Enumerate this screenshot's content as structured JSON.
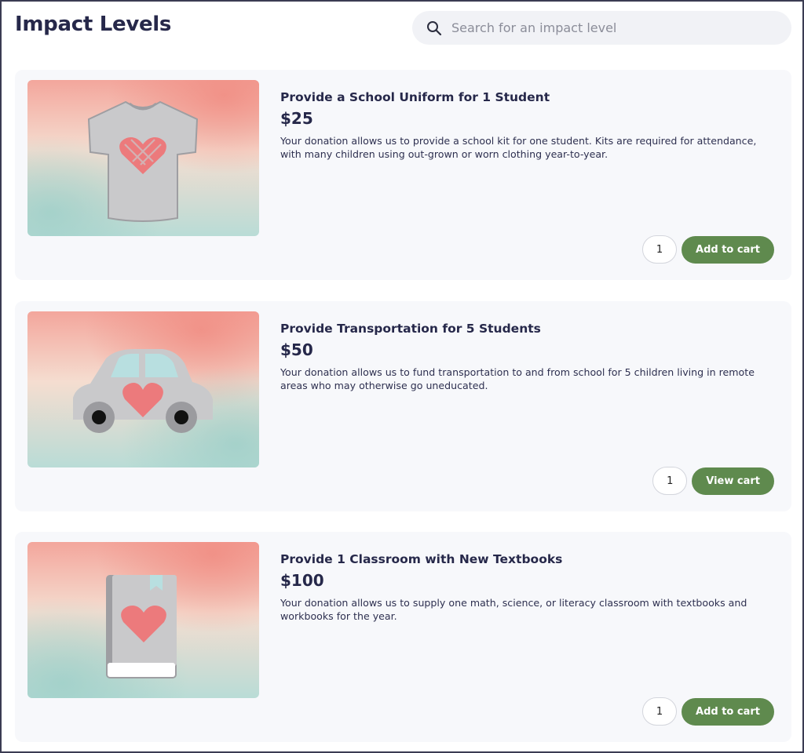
{
  "page": {
    "title": "Impact Levels"
  },
  "search": {
    "placeholder": "Search for an impact level",
    "icon": "search-icon"
  },
  "colors": {
    "button": "#5f8a4e",
    "title": "#26284a",
    "card_bg": "#f7f8fb"
  },
  "items": [
    {
      "title": "Provide a School Uniform for 1 Student",
      "price": "$25",
      "description": "Your donation allows us to provide a school kit for one student. Kits are required for attendance, with many children using out-grown or worn clothing year-to-year.",
      "quantity": "1",
      "button_label": "Add to cart",
      "image_icon": "tshirt-icon"
    },
    {
      "title": "Provide Transportation for 5 Students",
      "price": "$50",
      "description": "Your donation allows us to fund transportation to and from school for 5 children living in remote areas who may otherwise go uneducated.",
      "quantity": "1",
      "button_label": "View cart",
      "image_icon": "car-icon"
    },
    {
      "title": "Provide 1 Classroom with New Textbooks",
      "price": "$100",
      "description": "Your donation allows us to supply one math, science, or literacy classroom with textbooks and workbooks for the year.",
      "quantity": "1",
      "button_label": "Add to cart",
      "image_icon": "book-icon"
    }
  ]
}
